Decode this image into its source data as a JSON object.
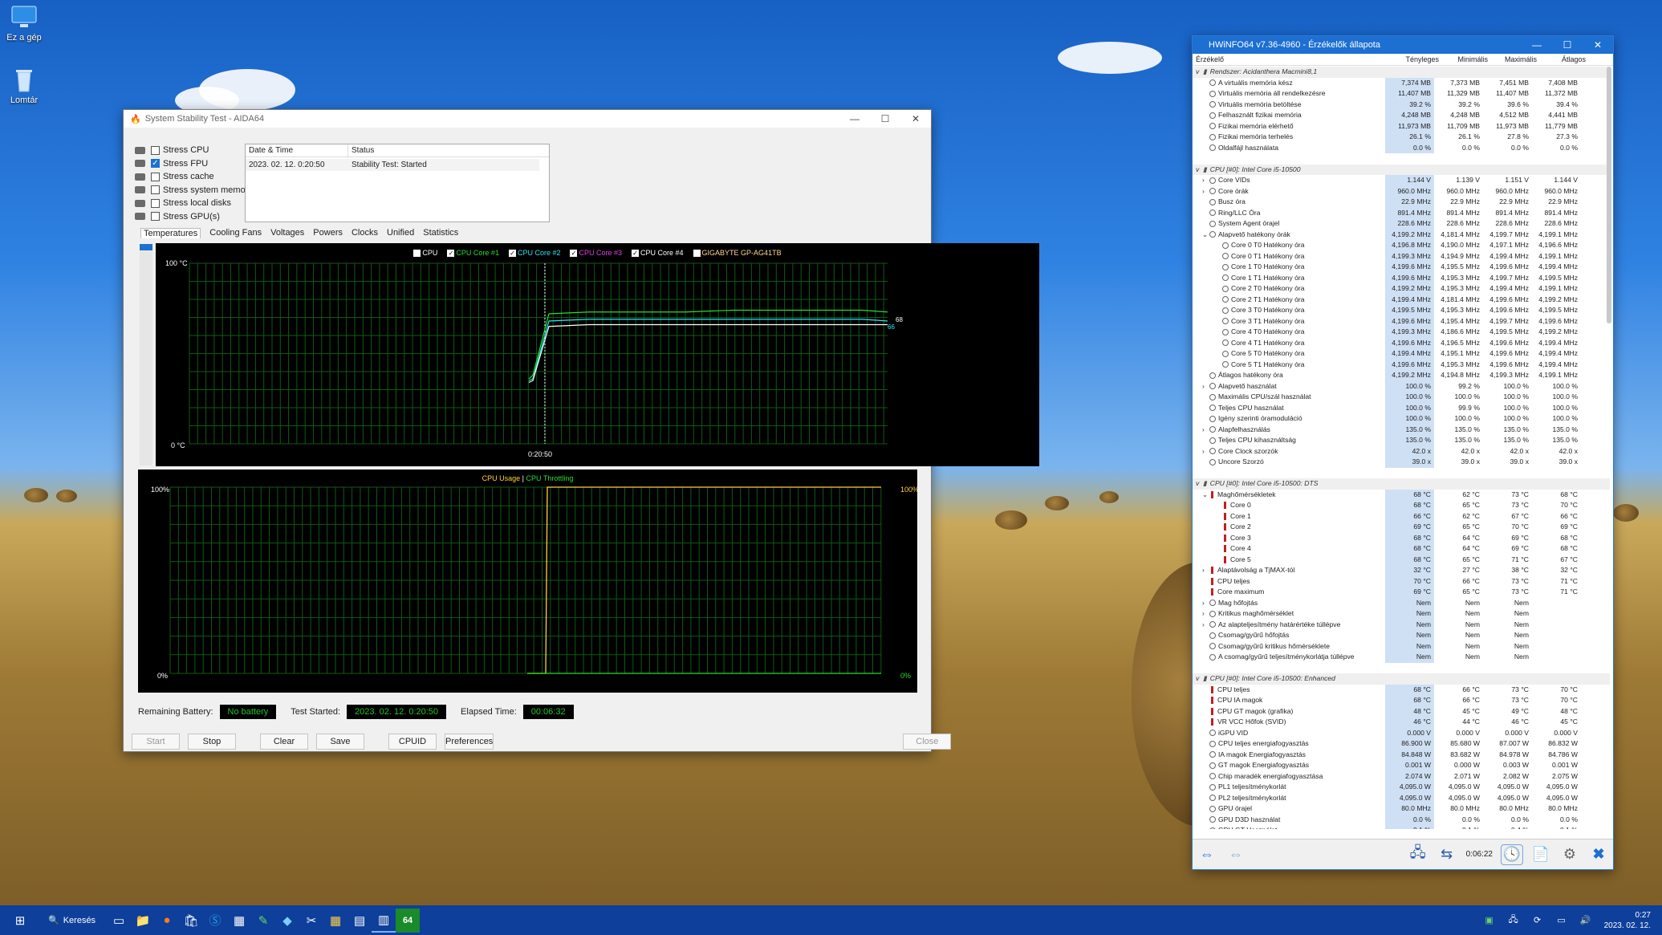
{
  "desktop": {
    "icons": [
      {
        "name": "Ez a gép",
        "icon": "monitor-icon"
      },
      {
        "name": "Lomtár",
        "icon": "recycle-bin-icon"
      }
    ]
  },
  "aida": {
    "title": "System Stability Test - AIDA64",
    "stress": [
      {
        "label": "Stress CPU",
        "checked": false
      },
      {
        "label": "Stress FPU",
        "checked": true
      },
      {
        "label": "Stress cache",
        "checked": false
      },
      {
        "label": "Stress system memory",
        "checked": false
      },
      {
        "label": "Stress local disks",
        "checked": false
      },
      {
        "label": "Stress GPU(s)",
        "checked": false
      }
    ],
    "status_table": {
      "col_date": "Date & Time",
      "col_status": "Status",
      "rows": [
        {
          "date": "2023. 02. 12. 0:20:50",
          "status": "Stability Test: Started"
        }
      ]
    },
    "tabs": [
      "Temperatures",
      "Cooling Fans",
      "Voltages",
      "Powers",
      "Clocks",
      "Unified",
      "Statistics"
    ],
    "active_tab": "Temperatures",
    "temp_legend": [
      {
        "label": "CPU",
        "checked": false,
        "color": "#ffffff"
      },
      {
        "label": "CPU Core #1",
        "checked": true,
        "color": "#22e02a"
      },
      {
        "label": "CPU Core #2",
        "checked": true,
        "color": "#2ae6f0"
      },
      {
        "label": "CPU Core #3",
        "checked": true,
        "color": "#e040e0"
      },
      {
        "label": "CPU Core #4",
        "checked": true,
        "color": "#ffffff"
      },
      {
        "label": "GIGABYTE GP-AG41TB",
        "checked": false,
        "color": "#ffd890"
      }
    ],
    "temp_axis": {
      "ymax": "100 °C",
      "ymin": "0 °C",
      "xlabel": "0:20:50",
      "end_val_a": "68",
      "end_val_b": "66"
    },
    "usage_legend": {
      "a": "CPU Usage",
      "sep": "|",
      "b": "CPU Throttling"
    },
    "usage_axis": {
      "ymax": "100%",
      "ymin": "0%",
      "rmax": "100%",
      "rmin": "0%"
    },
    "remaining_battery_label": "Remaining Battery:",
    "remaining_battery": "No battery",
    "test_started_label": "Test Started:",
    "test_started": "2023. 02. 12. 0:20:50",
    "elapsed_label": "Elapsed Time:",
    "elapsed": "00:06:32",
    "buttons": {
      "start": "Start",
      "stop": "Stop",
      "clear": "Clear",
      "save": "Save",
      "cpuid": "CPUID",
      "prefs": "Preferences",
      "close": "Close"
    }
  },
  "chart_data": [
    {
      "type": "line",
      "title": "",
      "ylabel": "°C",
      "ylim": [
        0,
        100
      ],
      "x_tick": "0:20:50",
      "series": [
        {
          "name": "CPU Core #1",
          "values": [
            36,
            38,
            72,
            73,
            73,
            73,
            74,
            74,
            74,
            74,
            73
          ]
        },
        {
          "name": "CPU Core #2",
          "values": [
            35,
            36,
            68,
            69,
            69,
            69,
            69,
            69,
            69,
            69,
            68
          ]
        },
        {
          "name": "CPU Core #4",
          "values": [
            34,
            35,
            65,
            66,
            66,
            66,
            66,
            66,
            66,
            66,
            66
          ]
        }
      ]
    },
    {
      "type": "line",
      "title": "",
      "ylim": [
        0,
        100
      ],
      "series": [
        {
          "name": "CPU Usage",
          "values": [
            0,
            0,
            100,
            100,
            100,
            100,
            100,
            100,
            100,
            100,
            100
          ]
        },
        {
          "name": "CPU Throttling",
          "values": [
            0,
            0,
            0,
            0,
            0,
            0,
            0,
            0,
            0,
            0,
            0
          ]
        }
      ]
    }
  ],
  "hwinfo": {
    "title": "HWiNFO64 v7.36-4960 - Érzékelők állapota",
    "headers": [
      "Érzékelő",
      "Tényleges",
      "Minimális",
      "Maximális",
      "Átlagos"
    ],
    "rows": [
      {
        "t": "g",
        "l": "Rendszer: Acidanthera Macmini8,1"
      },
      {
        "l": "A virtuális memória kész",
        "v": [
          "7,374 MB",
          "7,373 MB",
          "7,451 MB",
          "7,408 MB"
        ]
      },
      {
        "l": "Virtuális memória áll rendelkezésre",
        "v": [
          "11,407 MB",
          "11,329 MB",
          "11,407 MB",
          "11,372 MB"
        ]
      },
      {
        "l": "Virtuális memória betöltése",
        "v": [
          "39.2 %",
          "39.2 %",
          "39.6 %",
          "39.4 %"
        ]
      },
      {
        "l": "Felhasznált fizikai memória",
        "v": [
          "4,248 MB",
          "4,248 MB",
          "4,512 MB",
          "4,441 MB"
        ]
      },
      {
        "l": "Fizikai memória elérhető",
        "v": [
          "11,973 MB",
          "11,709 MB",
          "11,973 MB",
          "11,779 MB"
        ]
      },
      {
        "l": "Fizikai memória terhelés",
        "v": [
          "26.1 %",
          "26.1 %",
          "27.8 %",
          "27.3 %"
        ]
      },
      {
        "l": "Oldalfájl használata",
        "v": [
          "0.0 %",
          "0.0 %",
          "0.0 %",
          "0.0 %"
        ]
      },
      {
        "t": "b"
      },
      {
        "t": "g",
        "l": "CPU [#0]: Intel Core i5-10500"
      },
      {
        "a": ">",
        "l": "Core VIDs",
        "v": [
          "1.144 V",
          "1.139 V",
          "1.151 V",
          "1.144 V"
        ]
      },
      {
        "a": ">",
        "l": "Core órák",
        "v": [
          "960.0 MHz",
          "960.0 MHz",
          "960.0 MHz",
          "960.0 MHz"
        ]
      },
      {
        "l": "Busz óra",
        "v": [
          "22.9 MHz",
          "22.9 MHz",
          "22.9 MHz",
          "22.9 MHz"
        ]
      },
      {
        "l": "Ring/LLC Óra",
        "v": [
          "891.4 MHz",
          "891.4 MHz",
          "891.4 MHz",
          "891.4 MHz"
        ]
      },
      {
        "l": "System Agent órajel",
        "v": [
          "228.6 MHz",
          "228.6 MHz",
          "228.6 MHz",
          "228.6 MHz"
        ]
      },
      {
        "a": "v",
        "l": "Alapvető hatékony órák",
        "v": [
          "4,199.2 MHz",
          "4,181.4 MHz",
          "4,199.7 MHz",
          "4,199.1 MHz"
        ]
      },
      {
        "i": 1,
        "l": "Core 0 T0 Hatékony óra",
        "v": [
          "4,196.8 MHz",
          "4,190.0 MHz",
          "4,197.1 MHz",
          "4,196.6 MHz"
        ]
      },
      {
        "i": 1,
        "l": "Core 0 T1 Hatékony óra",
        "v": [
          "4,199.3 MHz",
          "4,194.9 MHz",
          "4,199.4 MHz",
          "4,199.1 MHz"
        ]
      },
      {
        "i": 1,
        "l": "Core 1 T0 Hatékony óra",
        "v": [
          "4,199.6 MHz",
          "4,195.5 MHz",
          "4,199.6 MHz",
          "4,199.4 MHz"
        ]
      },
      {
        "i": 1,
        "l": "Core 1 T1 Hatékony óra",
        "v": [
          "4,199.6 MHz",
          "4,195.3 MHz",
          "4,199.7 MHz",
          "4,199.5 MHz"
        ]
      },
      {
        "i": 1,
        "l": "Core 2 T0 Hatékony óra",
        "v": [
          "4,199.2 MHz",
          "4,195.3 MHz",
          "4,199.4 MHz",
          "4,199.1 MHz"
        ]
      },
      {
        "i": 1,
        "l": "Core 2 T1 Hatékony óra",
        "v": [
          "4,199.4 MHz",
          "4,181.4 MHz",
          "4,199.6 MHz",
          "4,199.2 MHz"
        ]
      },
      {
        "i": 1,
        "l": "Core 3 T0 Hatékony óra",
        "v": [
          "4,199.5 MHz",
          "4,195.3 MHz",
          "4,199.6 MHz",
          "4,199.5 MHz"
        ]
      },
      {
        "i": 1,
        "l": "Core 3 T1 Hatékony óra",
        "v": [
          "4,199.6 MHz",
          "4,195.4 MHz",
          "4,199.7 MHz",
          "4,199.6 MHz"
        ]
      },
      {
        "i": 1,
        "l": "Core 4 T0 Hatékony óra",
        "v": [
          "4,199.3 MHz",
          "4,186.6 MHz",
          "4,199.5 MHz",
          "4,199.2 MHz"
        ]
      },
      {
        "i": 1,
        "l": "Core 4 T1 Hatékony óra",
        "v": [
          "4,199.6 MHz",
          "4,196.5 MHz",
          "4,199.6 MHz",
          "4,199.4 MHz"
        ]
      },
      {
        "i": 1,
        "l": "Core 5 T0 Hatékony óra",
        "v": [
          "4,199.4 MHz",
          "4,195.1 MHz",
          "4,199.6 MHz",
          "4,199.4 MHz"
        ]
      },
      {
        "i": 1,
        "l": "Core 5 T1 Hatékony óra",
        "v": [
          "4,199.6 MHz",
          "4,195.3 MHz",
          "4,199.6 MHz",
          "4,199.4 MHz"
        ]
      },
      {
        "l": "Átlagos hatékony óra",
        "v": [
          "4,199.2 MHz",
          "4,194.8 MHz",
          "4,199.3 MHz",
          "4,199.1 MHz"
        ]
      },
      {
        "a": ">",
        "l": "Alapvető használat",
        "v": [
          "100.0 %",
          "99.2 %",
          "100.0 %",
          "100.0 %"
        ]
      },
      {
        "l": "Maximális CPU/szál használat",
        "v": [
          "100.0 %",
          "100.0 %",
          "100.0 %",
          "100.0 %"
        ]
      },
      {
        "l": "Teljes CPU használat",
        "v": [
          "100.0 %",
          "99.9 %",
          "100.0 %",
          "100.0 %"
        ]
      },
      {
        "l": "Igény szerinti óramoduláció",
        "v": [
          "100.0 %",
          "100.0 %",
          "100.0 %",
          "100.0 %"
        ]
      },
      {
        "a": ">",
        "l": "Alapfelhasználás",
        "v": [
          "135.0 %",
          "135.0 %",
          "135.0 %",
          "135.0 %"
        ]
      },
      {
        "l": "Teljes CPU kihasználtság",
        "v": [
          "135.0 %",
          "135.0 %",
          "135.0 %",
          "135.0 %"
        ]
      },
      {
        "a": ">",
        "l": "Core Clock szorzók",
        "v": [
          "42.0 x",
          "42.0 x",
          "42.0 x",
          "42.0 x"
        ]
      },
      {
        "l": "Uncore Szorzó",
        "v": [
          "39.0 x",
          "39.0 x",
          "39.0 x",
          "39.0 x"
        ]
      },
      {
        "t": "b"
      },
      {
        "t": "g",
        "l": "CPU [#0]: Intel Core i5-10500: DTS"
      },
      {
        "a": "v",
        "tc": 1,
        "l": "Maghőmérsékletek",
        "v": [
          "68 °C",
          "62 °C",
          "73 °C",
          "68 °C"
        ]
      },
      {
        "i": 1,
        "tc": 1,
        "l": "Core 0",
        "v": [
          "68 °C",
          "65 °C",
          "73 °C",
          "70 °C"
        ]
      },
      {
        "i": 1,
        "tc": 1,
        "l": "Core 1",
        "v": [
          "66 °C",
          "62 °C",
          "67 °C",
          "66 °C"
        ]
      },
      {
        "i": 1,
        "tc": 1,
        "l": "Core 2",
        "v": [
          "69 °C",
          "65 °C",
          "70 °C",
          "69 °C"
        ]
      },
      {
        "i": 1,
        "tc": 1,
        "l": "Core 3",
        "v": [
          "68 °C",
          "64 °C",
          "69 °C",
          "68 °C"
        ]
      },
      {
        "i": 1,
        "tc": 1,
        "l": "Core 4",
        "v": [
          "68 °C",
          "64 °C",
          "69 °C",
          "68 °C"
        ]
      },
      {
        "i": 1,
        "tc": 1,
        "l": "Core 5",
        "v": [
          "68 °C",
          "65 °C",
          "71 °C",
          "67 °C"
        ]
      },
      {
        "a": ">",
        "tc": 1,
        "l": "Alaptávolság a TjMAX-tól",
        "v": [
          "32 °C",
          "27 °C",
          "38 °C",
          "32 °C"
        ]
      },
      {
        "tc": 1,
        "l": "CPU teljes",
        "v": [
          "70 °C",
          "66 °C",
          "73 °C",
          "71 °C"
        ]
      },
      {
        "tc": 1,
        "l": "Core maximum",
        "v": [
          "69 °C",
          "65 °C",
          "73 °C",
          "71 °C"
        ]
      },
      {
        "a": ">",
        "l": "Mag hőfojtás",
        "v": [
          "Nem",
          "Nem",
          "Nem",
          ""
        ]
      },
      {
        "a": ">",
        "l": "Kritikus maghőmérséklet",
        "v": [
          "Nem",
          "Nem",
          "Nem",
          ""
        ]
      },
      {
        "a": ">",
        "l": "Az alapteljesítmény határértéke túllépve",
        "v": [
          "Nem",
          "Nem",
          "Nem",
          ""
        ]
      },
      {
        "l": "Csomag/gyűrű hőfojtás",
        "v": [
          "Nem",
          "Nem",
          "Nem",
          ""
        ]
      },
      {
        "l": "Csomag/gyűrű kritikus hőmérséklete",
        "v": [
          "Nem",
          "Nem",
          "Nem",
          ""
        ]
      },
      {
        "l": "A csomag/gyűrű teljesítménykorlátja túllépve",
        "v": [
          "Nem",
          "Nem",
          "Nem",
          ""
        ]
      },
      {
        "t": "b"
      },
      {
        "t": "g",
        "l": "CPU [#0]: Intel Core i5-10500: Enhanced"
      },
      {
        "tc": 1,
        "l": "CPU teljes",
        "v": [
          "68 °C",
          "66 °C",
          "73 °C",
          "70 °C"
        ]
      },
      {
        "tc": 1,
        "l": "CPU IA magok",
        "v": [
          "68 °C",
          "66 °C",
          "73 °C",
          "70 °C"
        ]
      },
      {
        "tc": 1,
        "l": "CPU GT magok (grafika)",
        "v": [
          "48 °C",
          "45 °C",
          "49 °C",
          "48 °C"
        ]
      },
      {
        "tc": 1,
        "l": "VR VCC Hőfok (SVID)",
        "v": [
          "46 °C",
          "44 °C",
          "46 °C",
          "45 °C"
        ]
      },
      {
        "l": "iGPU VID",
        "v": [
          "0.000 V",
          "0.000 V",
          "0.000 V",
          "0.000 V"
        ]
      },
      {
        "l": "CPU teljes energiafogyasztás",
        "v": [
          "86.900 W",
          "85.680 W",
          "87.007 W",
          "86.832 W"
        ]
      },
      {
        "l": "IA magok Energiafogyasztás",
        "v": [
          "84.848 W",
          "83.682 W",
          "84.978 W",
          "84.786 W"
        ]
      },
      {
        "l": "GT magok Energiafogyasztás",
        "v": [
          "0.001 W",
          "0.000 W",
          "0.003 W",
          "0.001 W"
        ]
      },
      {
        "l": "Chip maradék energiafogyasztása",
        "v": [
          "2.074 W",
          "2.071 W",
          "2.082 W",
          "2.075 W"
        ]
      },
      {
        "l": "PL1 teljesítménykorlát",
        "v": [
          "4,095.0 W",
          "4,095.0 W",
          "4,095.0 W",
          "4,095.0 W"
        ]
      },
      {
        "l": "PL2 teljesítménykorlát",
        "v": [
          "4,095.0 W",
          "4,095.0 W",
          "4,095.0 W",
          "4,095.0 W"
        ]
      },
      {
        "l": "GPU órajel",
        "v": [
          "80.0 MHz",
          "80.0 MHz",
          "80.0 MHz",
          "80.0 MHz"
        ]
      },
      {
        "l": "GPU D3D használat",
        "v": [
          "0.0 %",
          "0.0 %",
          "0.0 %",
          "0.0 %"
        ]
      },
      {
        "l": "GPU GT Használat",
        "v": [
          "0.1 %",
          "0.1 %",
          "0.4 %",
          "0.1 %"
        ]
      }
    ],
    "footer_time": "0:06:22"
  },
  "taskbar": {
    "search": "Keresés",
    "time": "0:27",
    "date": "2023. 02. 12."
  }
}
